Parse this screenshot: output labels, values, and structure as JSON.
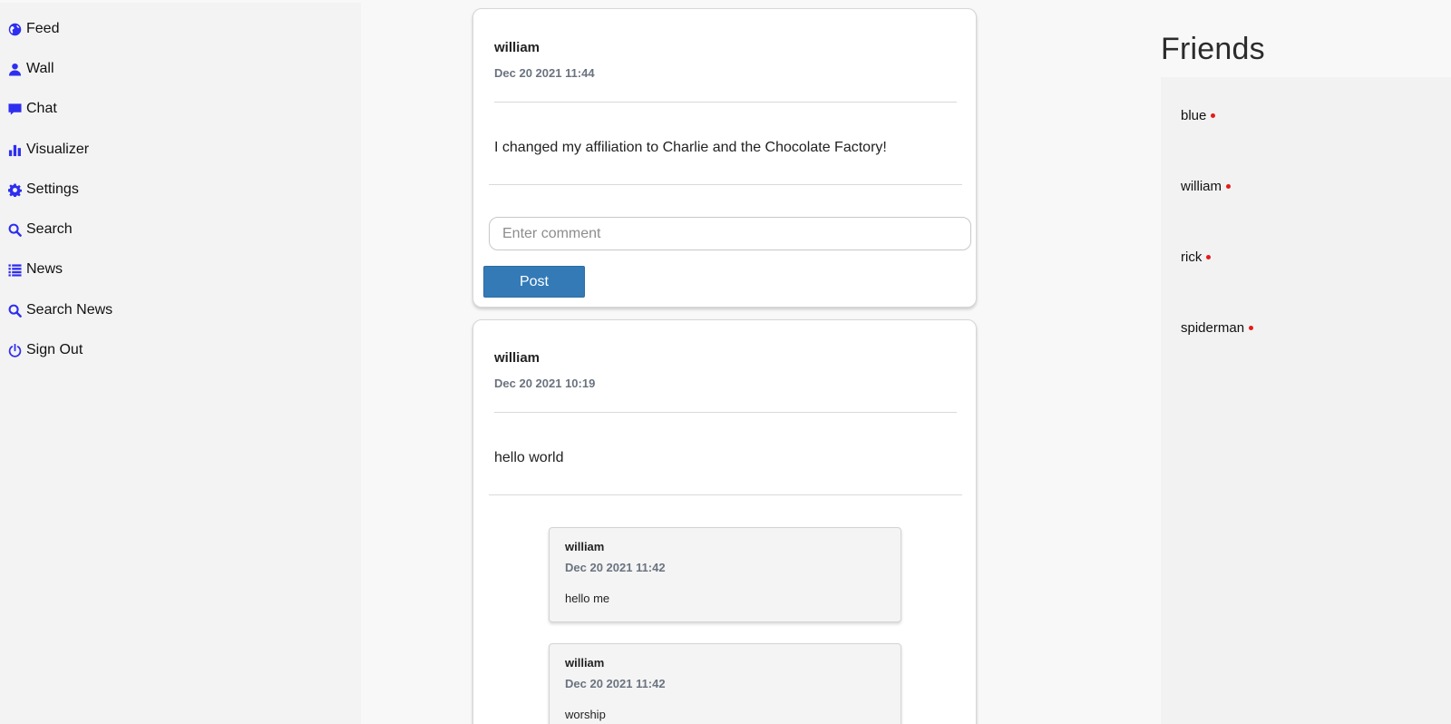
{
  "sidebar": {
    "items": [
      {
        "label": "Feed",
        "icon": "globe-icon"
      },
      {
        "label": "Wall",
        "icon": "user-icon"
      },
      {
        "label": "Chat",
        "icon": "chat-bubble-icon"
      },
      {
        "label": "Visualizer",
        "icon": "bar-chart-icon"
      },
      {
        "label": "Settings",
        "icon": "gear-icon"
      },
      {
        "label": "Search",
        "icon": "search-icon"
      },
      {
        "label": "News",
        "icon": "list-icon"
      },
      {
        "label": "Search News",
        "icon": "search-icon"
      },
      {
        "label": "Sign Out",
        "icon": "power-icon"
      }
    ],
    "icon_color": "#2e2ef0"
  },
  "feed": {
    "posts": [
      {
        "author": "william",
        "time": "Dec 20 2021 11:44",
        "text": "I changed my affiliation to Charlie and the Chocolate Factory!",
        "comment_placeholder": "Enter comment",
        "post_button_label": "Post"
      },
      {
        "author": "william",
        "time": "Dec 20 2021 10:19",
        "text": "hello world",
        "comments": [
          {
            "author": "william",
            "time": "Dec 20 2021 11:42",
            "text": "hello me"
          },
          {
            "author": "william",
            "time": "Dec 20 2021 11:42",
            "text": "worship"
          }
        ]
      }
    ],
    "button_color": "#337ab7"
  },
  "friends": {
    "title": "Friends",
    "list": [
      {
        "name": "blue",
        "status": "offline"
      },
      {
        "name": "william",
        "status": "offline"
      },
      {
        "name": "rick",
        "status": "offline"
      },
      {
        "name": "spiderman",
        "status": "offline"
      }
    ],
    "status_color": "#e81919"
  }
}
